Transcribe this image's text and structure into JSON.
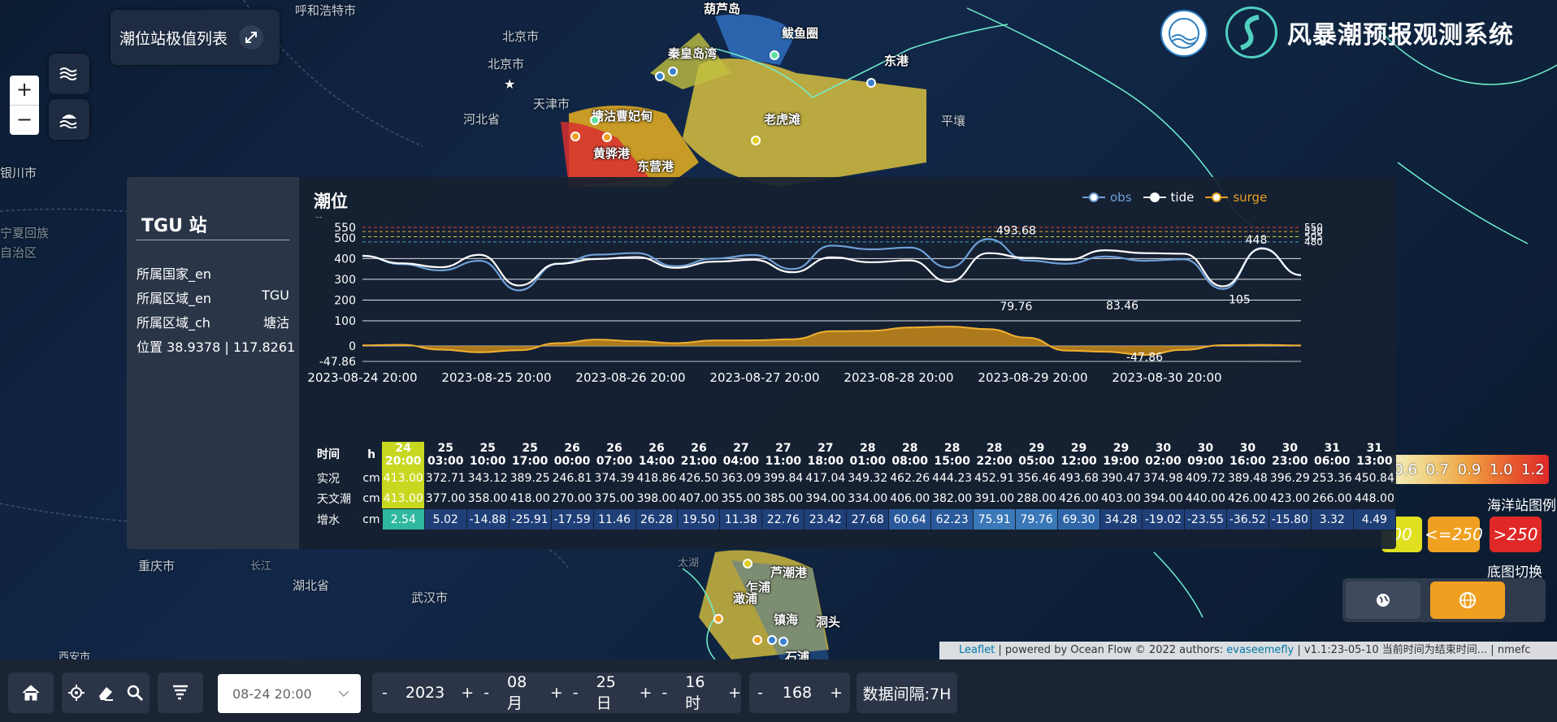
{
  "system_title": "风暴潮预报观测系统",
  "station_list_button": "潮位站极值列表",
  "map_labels": [
    "呼和浩特市",
    "北京市",
    "北京市",
    "天津市",
    "河北省",
    "平壤",
    "银川市",
    "宁夏回族",
    "自治区",
    "重庆市",
    "湖北省",
    "武汉市",
    "长江",
    "太湖",
    "西安市",
    "东港"
  ],
  "ports": [
    "葫芦岛",
    "鲅鱼圈",
    "秦皇岛湾",
    "塘沽曹妃甸",
    "老虎滩",
    "黄骅港",
    "东营港",
    "芦潮港",
    "乍浦",
    "澉浦",
    "镇海",
    "洞头",
    "石浦"
  ],
  "map_legend": {
    "gradient_values": [
      "0.6",
      "0.7",
      "0.9",
      "1.0",
      "1.2"
    ],
    "ocean_station_title": "海洋站图例",
    "items": [
      {
        "label": "<=250",
        "color": "#f0a020"
      },
      {
        "label": ">250",
        "color": "#e02828"
      }
    ],
    "partial_item": "00",
    "basemap_title": "底图切换"
  },
  "attribution": {
    "link1": "Leaflet",
    "text1": " | powered by Ocean Flow © 2022 authors: ",
    "link2": "evaseemefly",
    "text2": " | v1.1:23-05-10 当前时间为结束时间... | nmefc"
  },
  "panel": {
    "station_title": "TGU 站",
    "info": [
      {
        "label": "所属国家_en",
        "value": ""
      },
      {
        "label": "所属区域_en",
        "value": "TGU"
      },
      {
        "label": "所属区域_ch",
        "value": "塘沽"
      },
      {
        "label": "位置",
        "value": "38.9378 | 117.8261"
      }
    ],
    "chart_title": "潮位",
    "chart_subtitle": "--",
    "legend": [
      {
        "name": "obs",
        "color": "#6fa0d8"
      },
      {
        "name": "tide",
        "color": "#ffffff"
      },
      {
        "name": "surge",
        "color": "#e8a020"
      }
    ]
  },
  "chart_data": {
    "type": "line",
    "x_labels": [
      "2023-08-24 20:00",
      "2023-08-25 20:00",
      "2023-08-26 20:00",
      "2023-08-27 20:00",
      "2023-08-28 20:00",
      "2023-08-29 20:00",
      "2023-08-30 20:00"
    ],
    "y_ticks": [
      550,
      500,
      400,
      300,
      200,
      100,
      0,
      -47.86
    ],
    "threshold_lines": [
      {
        "value": 550,
        "color": "#e04040"
      },
      {
        "value": 530,
        "color": "#e0a030"
      },
      {
        "value": 505,
        "color": "#d0d040"
      },
      {
        "value": 480,
        "color": "#40a0d0"
      }
    ],
    "threshold_labels": [
      "550",
      "530",
      "505",
      "480"
    ],
    "annotations": [
      {
        "label": "493.68",
        "x": 117,
        "y": 493.68
      },
      {
        "label": "448",
        "x": 160,
        "y": 448
      },
      {
        "label": "79.76",
        "x": 117,
        "y": 79.76
      },
      {
        "label": "83.46",
        "x": 136,
        "y": 83.46
      },
      {
        "label": "105",
        "x": 157,
        "y": 105
      },
      {
        "label": "-47.86",
        "x": 140,
        "y": -47.86
      }
    ],
    "ylim": [
      -47.86,
      550
    ],
    "xlim": [
      0,
      168
    ],
    "series": [
      {
        "name": "obs",
        "color": "#6fa0d8",
        "x": [
          0,
          7,
          14,
          21,
          28,
          35,
          42,
          49,
          56,
          63,
          70,
          77,
          84,
          91,
          98,
          105,
          112,
          119,
          126,
          133,
          140,
          147,
          154,
          161,
          168
        ],
        "values": [
          413,
          372.71,
          343.12,
          389.25,
          246.81,
          374.39,
          418.86,
          426.5,
          363.09,
          399.84,
          417.04,
          349.32,
          462.26,
          444.23,
          452.91,
          356.46,
          493.68,
          390.47,
          374.98,
          409.72,
          389.48,
          396.29,
          253.36,
          450.84,
          320
        ]
      },
      {
        "name": "tide",
        "color": "#ffffff",
        "x": [
          0,
          7,
          14,
          21,
          28,
          35,
          42,
          49,
          56,
          63,
          70,
          77,
          84,
          91,
          98,
          105,
          112,
          119,
          126,
          133,
          140,
          147,
          154,
          161,
          168
        ],
        "values": [
          413,
          377,
          358,
          418,
          270,
          375,
          398,
          407,
          355,
          385,
          394,
          334,
          406,
          382,
          391,
          288,
          426,
          403,
          394,
          440,
          426,
          423,
          266,
          448,
          320
        ]
      },
      {
        "name": "surge",
        "color": "#e8a020",
        "x": [
          0,
          7,
          14,
          21,
          28,
          35,
          42,
          49,
          56,
          63,
          70,
          77,
          84,
          91,
          98,
          105,
          112,
          119,
          126,
          133,
          140,
          147,
          154,
          161,
          168
        ],
        "values": [
          2.54,
          5.02,
          -14.88,
          -25.91,
          -17.59,
          11.46,
          26.28,
          19.5,
          11.38,
          22.76,
          23.42,
          27.68,
          60.64,
          62.23,
          75.91,
          79.76,
          69.3,
          34.28,
          -19.02,
          -23.55,
          -36.52,
          -15.8,
          3.32,
          4.49,
          2
        ]
      }
    ]
  },
  "table": {
    "row_labels": [
      {
        "name": "时间",
        "unit": "h"
      },
      {
        "name": "实况",
        "unit": "cm"
      },
      {
        "name": "天文潮",
        "unit": "cm"
      },
      {
        "name": "增水",
        "unit": "cm"
      }
    ],
    "columns": [
      {
        "day": "24",
        "time": "20:00",
        "obs": "413.00",
        "tide": "413.00",
        "surge": "2.54",
        "surge_color": "#2fb8a0"
      },
      {
        "day": "25",
        "time": "03:00",
        "obs": "372.71",
        "tide": "377.00",
        "surge": "5.02",
        "surge_color": "#1f3f78"
      },
      {
        "day": "25",
        "time": "10:00",
        "obs": "343.12",
        "tide": "358.00",
        "surge": "-14.88",
        "surge_color": "#1f3f78"
      },
      {
        "day": "25",
        "time": "17:00",
        "obs": "389.25",
        "tide": "418.00",
        "surge": "-25.91",
        "surge_color": "#1f3f78"
      },
      {
        "day": "26",
        "time": "00:00",
        "obs": "246.81",
        "tide": "270.00",
        "surge": "-17.59",
        "surge_color": "#1f3f78"
      },
      {
        "day": "26",
        "time": "07:00",
        "obs": "374.39",
        "tide": "375.00",
        "surge": "11.46",
        "surge_color": "#1f3f78"
      },
      {
        "day": "26",
        "time": "14:00",
        "obs": "418.86",
        "tide": "398.00",
        "surge": "26.28",
        "surge_color": "#1f3f78"
      },
      {
        "day": "26",
        "time": "21:00",
        "obs": "426.50",
        "tide": "407.00",
        "surge": "19.50",
        "surge_color": "#1f3f78"
      },
      {
        "day": "27",
        "time": "04:00",
        "obs": "363.09",
        "tide": "355.00",
        "surge": "11.38",
        "surge_color": "#1f3f78"
      },
      {
        "day": "27",
        "time": "11:00",
        "obs": "399.84",
        "tide": "385.00",
        "surge": "22.76",
        "surge_color": "#1f3f78"
      },
      {
        "day": "27",
        "time": "18:00",
        "obs": "417.04",
        "tide": "394.00",
        "surge": "23.42",
        "surge_color": "#1f3f78"
      },
      {
        "day": "28",
        "time": "01:00",
        "obs": "349.32",
        "tide": "334.00",
        "surge": "27.68",
        "surge_color": "#1f3f78"
      },
      {
        "day": "28",
        "time": "08:00",
        "obs": "462.26",
        "tide": "406.00",
        "surge": "60.64",
        "surge_color": "#2a5a9c"
      },
      {
        "day": "28",
        "time": "15:00",
        "obs": "444.23",
        "tide": "382.00",
        "surge": "62.23",
        "surge_color": "#2a5a9c"
      },
      {
        "day": "28",
        "time": "22:00",
        "obs": "452.91",
        "tide": "391.00",
        "surge": "75.91",
        "surge_color": "#3a78b8"
      },
      {
        "day": "29",
        "time": "05:00",
        "obs": "356.46",
        "tide": "288.00",
        "surge": "79.76",
        "surge_color": "#3a78b8"
      },
      {
        "day": "29",
        "time": "12:00",
        "obs": "493.68",
        "tide": "426.00",
        "surge": "69.30",
        "surge_color": "#2f66a8"
      },
      {
        "day": "29",
        "time": "19:00",
        "obs": "390.47",
        "tide": "403.00",
        "surge": "34.28",
        "surge_color": "#1f3f78"
      },
      {
        "day": "30",
        "time": "02:00",
        "obs": "374.98",
        "tide": "394.00",
        "surge": "-19.02",
        "surge_color": "#1f3f78"
      },
      {
        "day": "30",
        "time": "09:00",
        "obs": "409.72",
        "tide": "440.00",
        "surge": "-23.55",
        "surge_color": "#1f3f78"
      },
      {
        "day": "30",
        "time": "16:00",
        "obs": "389.48",
        "tide": "426.00",
        "surge": "-36.52",
        "surge_color": "#1f3f78"
      },
      {
        "day": "30",
        "time": "23:00",
        "obs": "396.29",
        "tide": "423.00",
        "surge": "-15.80",
        "surge_color": "#1f3f78"
      },
      {
        "day": "31",
        "time": "06:00",
        "obs": "253.36",
        "tide": "266.00",
        "surge": "3.32",
        "surge_color": "#1f3f78"
      },
      {
        "day": "31",
        "time": "13:00",
        "obs": "450.84",
        "tide": "448.00",
        "surge": "4.49",
        "surge_color": "#1f3f78"
      }
    ]
  },
  "bottom": {
    "date_select": "08-24 20:00",
    "year": "2023",
    "month": "08月",
    "day": "25日",
    "hour": "16时",
    "span": "168",
    "interval": "数据间隔:7H"
  }
}
